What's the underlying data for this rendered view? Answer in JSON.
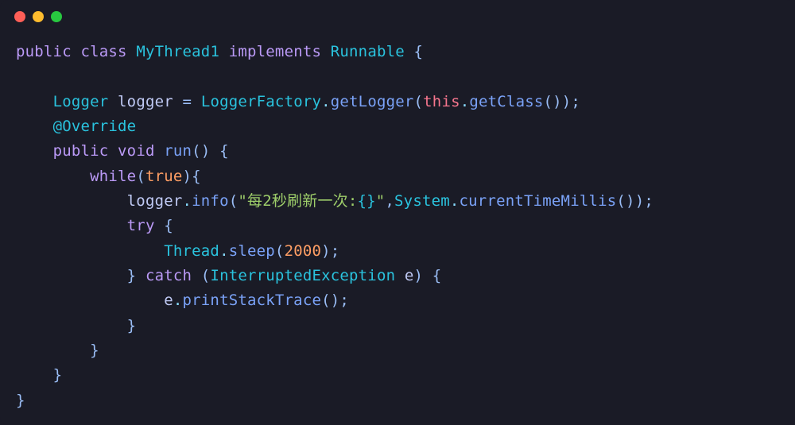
{
  "titlebar": {
    "close": "close",
    "min": "minimize",
    "max": "maximize"
  },
  "code": {
    "kw_public": "public",
    "kw_class": "class",
    "cls_name": "MyThread1",
    "kw_implements": "implements",
    "iface": "Runnable",
    "brace_open": "{",
    "brace_close": "}",
    "type_Logger": "Logger",
    "ident_logger": "logger",
    "eq": "=",
    "type_LoggerFactory": "LoggerFactory",
    "method_getLogger": "getLogger",
    "kw_this": "this",
    "method_getClass": "getClass",
    "paren_open": "(",
    "paren_close": ")",
    "semi": ";",
    "anno_Override": "@Override",
    "kw_void": "void",
    "method_run": "run",
    "kw_while": "while",
    "lit_true": "true",
    "method_info": "info",
    "str_quote": "\"",
    "str_body": "每2秒刷新一次:",
    "str_placeholder": "{}",
    "comma": ",",
    "type_System": "System",
    "method_currentTimeMillis": "currentTimeMillis",
    "kw_try": "try",
    "type_Thread": "Thread",
    "method_sleep": "sleep",
    "lit_2000": "2000",
    "kw_catch": "catch",
    "type_IEx": "InterruptedException",
    "ident_e": "e",
    "method_printStackTrace": "printStackTrace",
    "dot": "."
  }
}
